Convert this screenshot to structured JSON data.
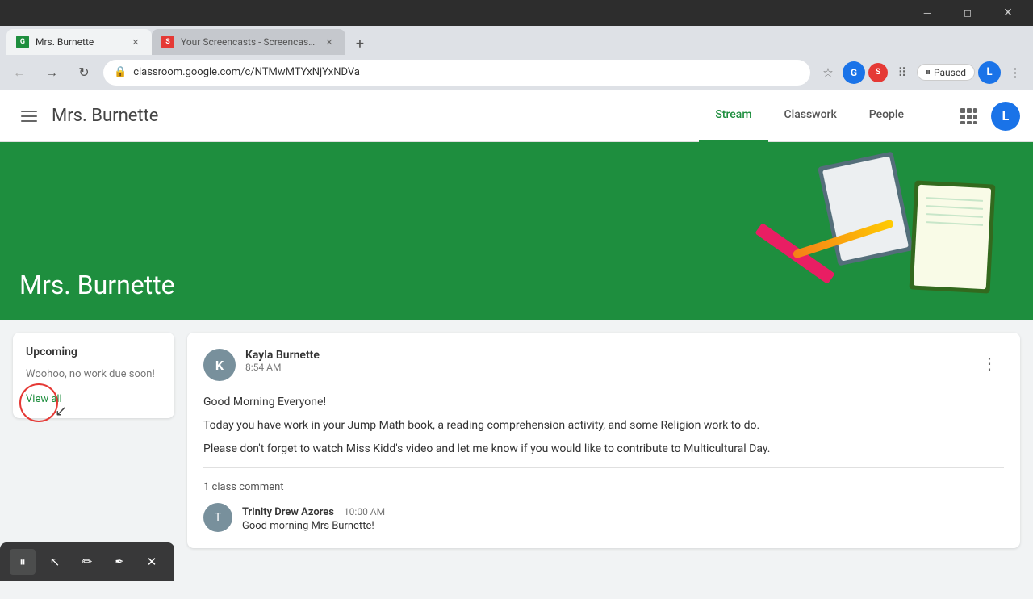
{
  "browser": {
    "tabs": [
      {
        "id": "tab1",
        "label": "Mrs. Burnette",
        "active": true,
        "favicon": "classroom"
      },
      {
        "id": "tab2",
        "label": "Your Screencasts - Screencastify",
        "active": false,
        "favicon": "screencastify"
      }
    ],
    "address": "classroom.google.com/c/NTMwMTYxNjYxNDVa",
    "paused_label": "Paused",
    "user_initial": "L"
  },
  "app": {
    "title": "Mrs. Burnette",
    "nav": [
      {
        "id": "stream",
        "label": "Stream",
        "active": true
      },
      {
        "id": "classwork",
        "label": "Classwork",
        "active": false
      },
      {
        "id": "people",
        "label": "People",
        "active": false
      }
    ],
    "user_initial": "L"
  },
  "banner": {
    "title": "Mrs. Burnette"
  },
  "upcoming": {
    "title": "Upcoming",
    "empty_text": "Woohoo, no work due soon!",
    "view_all_label": "View all"
  },
  "post": {
    "author": "Kayla Burnette",
    "time": "8:54 AM",
    "avatar_initial": "K",
    "body_line1": "Good Morning Everyone!",
    "body_line2": "Today you have work in your Jump Math book, a reading comprehension activity, and some Religion work to do.",
    "body_line3": "Please don't forget to watch Miss Kidd's video and let me know if you would like to contribute to Multicultural Day.",
    "comment_count": "1 class comment",
    "comment_author": "Trinity Drew Azores",
    "comment_time": "10:00 AM",
    "comment_text": "Good morning Mrs Burnette!",
    "comment_avatar_initial": "T"
  },
  "screencast": {
    "pause_icon": "⏸",
    "cursor_icon": "↖",
    "pen_icon": "✏",
    "marker_icon": "✒",
    "close_icon": "✕"
  }
}
